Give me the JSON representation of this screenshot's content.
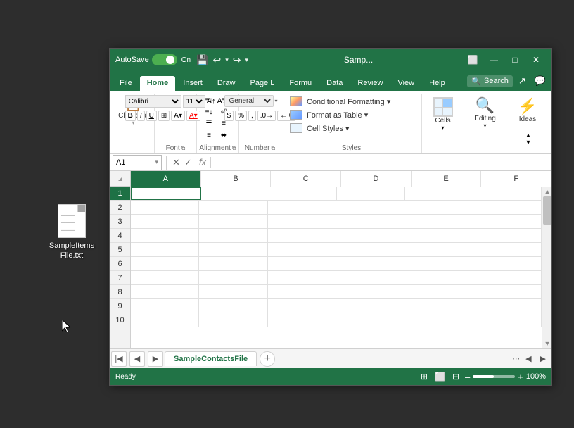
{
  "window": {
    "title": "Samp...",
    "autosave_label": "AutoSave",
    "autosave_state": "On"
  },
  "ribbon": {
    "tabs": [
      "File",
      "Home",
      "Insert",
      "Draw",
      "Page L",
      "Formu",
      "Data",
      "Review",
      "View",
      "Help"
    ],
    "active_tab": "Home",
    "search_placeholder": "Search",
    "groups": {
      "clipboard": {
        "label": "Clipboard"
      },
      "font": {
        "label": "Font"
      },
      "alignment": {
        "label": "Alignment"
      },
      "number": {
        "label": "Number"
      },
      "styles": {
        "label": "Styles",
        "items": [
          "Conditional Formatting ▾",
          "Format as Table ▾",
          "Cell Styles ▾"
        ]
      },
      "cells": {
        "label": "Cells"
      },
      "editing": {
        "label": "Editing"
      },
      "ideas": {
        "label": "Ideas"
      }
    }
  },
  "formula_bar": {
    "cell_ref": "A1",
    "fx_symbol": "fx"
  },
  "spreadsheet": {
    "columns": [
      "A",
      "B",
      "C",
      "D",
      "E",
      "F"
    ],
    "rows": [
      1,
      2,
      3,
      4,
      5,
      6,
      7,
      8,
      9,
      10
    ],
    "selected_cell": "A1"
  },
  "sheet_tabs": [
    {
      "name": "SampleContactsFile",
      "active": true
    }
  ],
  "status_bar": {
    "zoom": "100%",
    "zoom_pct": 100
  },
  "desktop_icon": {
    "label": "SampleItems\nFile.txt",
    "line1": "SampleItems",
    "line2": "File.txt"
  },
  "toolbar": {
    "save_icon": "💾",
    "undo_label": "↩",
    "redo_label": "↪"
  }
}
